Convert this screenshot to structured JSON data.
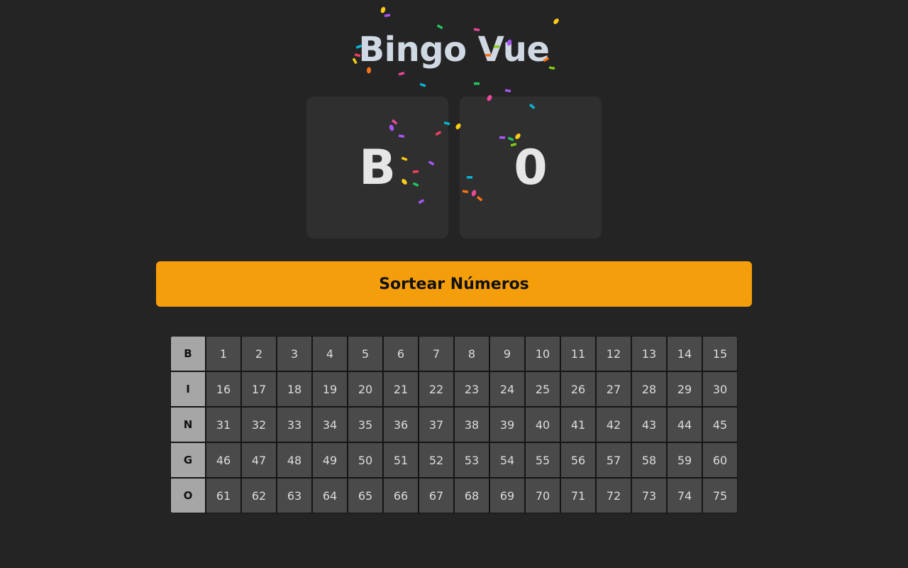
{
  "app": {
    "title": "Bingo Vue"
  },
  "display": {
    "letter": "B",
    "number": "0"
  },
  "actions": {
    "draw_label": "Sortear Números"
  },
  "board": {
    "rows": [
      {
        "letter": "B",
        "numbers": [
          "1",
          "2",
          "3",
          "4",
          "5",
          "6",
          "7",
          "8",
          "9",
          "10",
          "11",
          "12",
          "13",
          "14",
          "15"
        ]
      },
      {
        "letter": "I",
        "numbers": [
          "16",
          "17",
          "18",
          "19",
          "20",
          "21",
          "22",
          "23",
          "24",
          "25",
          "26",
          "27",
          "28",
          "29",
          "30"
        ]
      },
      {
        "letter": "N",
        "numbers": [
          "31",
          "32",
          "33",
          "34",
          "35",
          "36",
          "37",
          "38",
          "39",
          "40",
          "41",
          "42",
          "43",
          "44",
          "45"
        ]
      },
      {
        "letter": "G",
        "numbers": [
          "46",
          "47",
          "48",
          "49",
          "50",
          "51",
          "52",
          "53",
          "54",
          "55",
          "56",
          "57",
          "58",
          "59",
          "60"
        ]
      },
      {
        "letter": "O",
        "numbers": [
          "61",
          "62",
          "63",
          "64",
          "65",
          "66",
          "67",
          "68",
          "69",
          "70",
          "71",
          "72",
          "73",
          "74",
          "75"
        ]
      }
    ]
  },
  "colors": {
    "background": "#242424",
    "accent": "#f59e0b",
    "title": "#cfd8e3",
    "card": "#2f2f2f",
    "letter_cell": "#a6a6a6",
    "number_cell": "#4a4a4a",
    "confetti": [
      "#facc15",
      "#a855f7",
      "#ec4899",
      "#22c55e",
      "#06b6d4",
      "#f97316",
      "#84cc16",
      "#f43f5e"
    ]
  }
}
